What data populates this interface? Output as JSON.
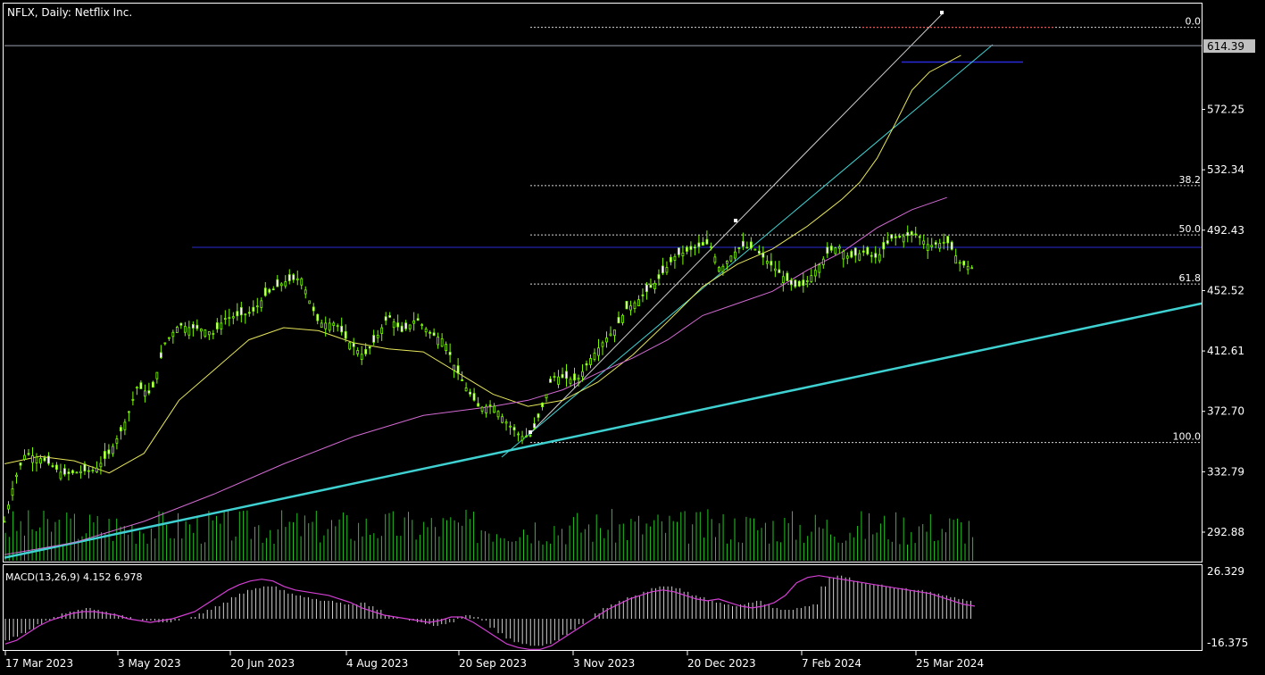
{
  "title": "NFLX, Daily:  Netflix Inc.",
  "macd_label": "MACD(13,26,9) 4.152 6.978",
  "colors": {
    "background": "#000000",
    "candle": "#7CFC00",
    "ma_short": "#e6e65a",
    "ma_long": "#d36ad3",
    "trendline": "#3fd1d1",
    "resistance": "#2a2ad8",
    "macd_signal": "#d23fd2",
    "volume": "#22c322",
    "fib_top": "#ff4040",
    "grid": "#ffffff"
  },
  "chart_data": [
    {
      "type": "candlestick",
      "ylim": [
        274,
        641
      ],
      "y_ticks": [
        572.25,
        532.34,
        492.43,
        452.52,
        412.61,
        372.7,
        332.79,
        292.88
      ],
      "y_tick_labels": [
        "572.25",
        "532.34",
        "492.43",
        "452.52",
        "412.61",
        "372.70",
        "332.79",
        "292.88"
      ],
      "current_price": 614.39,
      "current_price_label": "614.39",
      "x_tick_labels": [
        "17 Mar 2023",
        "3 May 2023",
        "20 Jun 2023",
        "4 Aug 2023",
        "20 Sep 2023",
        "3 Nov 2023",
        "20 Dec 2023",
        "7 Feb 2024",
        "25 Mar 2024"
      ],
      "fibonacci": [
        {
          "label": "0.0",
          "price": 626.5
        },
        {
          "label": "38.2",
          "price": 521.9
        },
        {
          "label": "50.0",
          "price": 489.3
        },
        {
          "label": "61.8",
          "price": 456.8
        },
        {
          "label": "100.0",
          "price": 352.1
        }
      ],
      "horizontal_levels": [
        {
          "name": "resistance",
          "price": 481.1
        },
        {
          "name": "support",
          "price": 603.5
        }
      ],
      "close_path": [
        [
          0,
          300
        ],
        [
          6,
          328
        ],
        [
          12,
          345
        ],
        [
          22,
          341
        ],
        [
          34,
          331
        ],
        [
          44,
          333
        ],
        [
          52,
          334
        ],
        [
          60,
          345
        ],
        [
          66,
          358
        ],
        [
          70,
          368
        ],
        [
          76,
          389
        ],
        [
          84,
          384
        ],
        [
          92,
          418
        ],
        [
          100,
          430
        ],
        [
          106,
          428
        ],
        [
          114,
          427
        ],
        [
          120,
          424
        ],
        [
          126,
          434
        ],
        [
          134,
          436
        ],
        [
          142,
          438
        ],
        [
          150,
          450
        ],
        [
          160,
          458
        ],
        [
          170,
          461
        ],
        [
          174,
          448
        ],
        [
          180,
          431
        ],
        [
          190,
          431
        ],
        [
          196,
          420
        ],
        [
          206,
          409
        ],
        [
          212,
          419
        ],
        [
          220,
          436
        ],
        [
          228,
          425
        ],
        [
          236,
          434
        ],
        [
          244,
          424
        ],
        [
          252,
          420
        ],
        [
          258,
          402
        ],
        [
          264,
          389
        ],
        [
          272,
          375
        ],
        [
          280,
          377
        ],
        [
          288,
          365
        ],
        [
          296,
          356
        ],
        [
          302,
          357
        ],
        [
          308,
          375
        ],
        [
          314,
          396
        ],
        [
          320,
          395
        ],
        [
          328,
          393
        ],
        [
          336,
          408
        ],
        [
          344,
          420
        ],
        [
          350,
          427
        ],
        [
          356,
          440
        ],
        [
          364,
          447
        ],
        [
          374,
          459
        ],
        [
          384,
          475
        ],
        [
          394,
          480
        ],
        [
          404,
          484
        ],
        [
          410,
          466
        ],
        [
          416,
          475
        ],
        [
          422,
          482
        ],
        [
          430,
          480
        ],
        [
          436,
          473
        ],
        [
          446,
          462
        ],
        [
          452,
          455
        ],
        [
          458,
          456
        ],
        [
          466,
          468
        ],
        [
          472,
          478
        ],
        [
          478,
          482
        ],
        [
          484,
          474
        ],
        [
          492,
          478
        ],
        [
          500,
          474
        ],
        [
          508,
          487
        ],
        [
          514,
          488
        ],
        [
          522,
          490
        ],
        [
          530,
          482
        ],
        [
          540,
          485
        ],
        [
          548,
          470
        ],
        [
          556,
          467
        ]
      ],
      "ma_short_path": [
        [
          0,
          338
        ],
        [
          20,
          343
        ],
        [
          40,
          340
        ],
        [
          60,
          332
        ],
        [
          80,
          345
        ],
        [
          100,
          380
        ],
        [
          120,
          400
        ],
        [
          140,
          420
        ],
        [
          160,
          428
        ],
        [
          180,
          426
        ],
        [
          200,
          418
        ],
        [
          220,
          414
        ],
        [
          240,
          412
        ],
        [
          260,
          398
        ],
        [
          280,
          384
        ],
        [
          300,
          376
        ],
        [
          320,
          380
        ],
        [
          340,
          392
        ],
        [
          360,
          410
        ],
        [
          380,
          432
        ],
        [
          400,
          455
        ],
        [
          420,
          470
        ],
        [
          440,
          480
        ],
        [
          460,
          495
        ],
        [
          470,
          504
        ],
        [
          480,
          513
        ],
        [
          490,
          524
        ],
        [
          500,
          540
        ],
        [
          510,
          562
        ],
        [
          520,
          585
        ],
        [
          530,
          597
        ],
        [
          540,
          603
        ],
        [
          548,
          608
        ]
      ],
      "ma_long_path": [
        [
          0,
          278
        ],
        [
          40,
          286
        ],
        [
          80,
          300
        ],
        [
          120,
          318
        ],
        [
          160,
          338
        ],
        [
          200,
          356
        ],
        [
          240,
          370
        ],
        [
          280,
          376
        ],
        [
          300,
          380
        ],
        [
          320,
          387
        ],
        [
          340,
          398
        ],
        [
          360,
          408
        ],
        [
          380,
          420
        ],
        [
          400,
          436
        ],
        [
          420,
          444
        ],
        [
          440,
          452
        ],
        [
          460,
          466
        ],
        [
          480,
          478
        ],
        [
          500,
          494
        ],
        [
          520,
          506
        ],
        [
          540,
          514
        ]
      ],
      "trendlines": [
        {
          "name": "long-trend",
          "from": [
            0,
            276
          ],
          "to": [
            666,
            444
          ]
        },
        {
          "name": "channel-upper",
          "from": [
            296,
            352
          ],
          "to": [
            526,
            626
          ]
        },
        {
          "name": "channel-lower",
          "from": [
            280,
            344
          ],
          "to": [
            556,
            606
          ]
        }
      ],
      "volume": [
        7,
        6,
        8,
        5,
        9,
        7,
        6,
        8,
        9,
        7,
        5,
        6,
        8,
        9,
        7,
        6,
        5,
        8,
        7,
        9
      ]
    },
    {
      "type": "macd",
      "ylim": [
        -16.375,
        26.329
      ],
      "y_tick_labels": [
        "26.329",
        "-16.375"
      ],
      "histogram": [
        -12,
        -10,
        -8,
        -6,
        -3,
        -1,
        1,
        3,
        4,
        5,
        6,
        5,
        4,
        3,
        2,
        1,
        0,
        -1,
        -1,
        -2,
        -2,
        -1,
        0,
        1,
        3,
        5,
        7,
        9,
        12,
        14,
        16,
        17,
        18,
        18,
        16,
        14,
        13,
        12,
        11,
        10,
        10,
        9,
        8,
        8,
        9,
        7,
        5,
        2,
        1,
        0,
        -1,
        -2,
        -3,
        -4,
        -3,
        -2,
        1,
        2,
        1,
        -1,
        -5,
        -8,
        -11,
        -13,
        -14,
        -15,
        -15,
        -14,
        -12,
        -9,
        -6,
        -3,
        0,
        3,
        6,
        8,
        10,
        12,
        13,
        15,
        17,
        18,
        18,
        17,
        15,
        13,
        12,
        10,
        9,
        8,
        7,
        8,
        9,
        10,
        8,
        6,
        5,
        5,
        6,
        7,
        8,
        18,
        23,
        24,
        23,
        21,
        20,
        19,
        19,
        18,
        17,
        17,
        16,
        16,
        15,
        14,
        13,
        12,
        11,
        10
      ],
      "signal": [
        -14,
        -12,
        -8,
        -4,
        -1,
        1,
        3,
        4,
        4,
        3,
        2,
        0,
        -1,
        -2,
        -1,
        0,
        2,
        4,
        8,
        12,
        16,
        19,
        21,
        22,
        21,
        18,
        16,
        15,
        14,
        13,
        11,
        9,
        6,
        4,
        2,
        1,
        0,
        -1,
        -2,
        -1,
        1,
        1,
        -2,
        -6,
        -10,
        -14,
        -16,
        -17,
        -17,
        -15,
        -11,
        -7,
        -3,
        1,
        5,
        8,
        11,
        13,
        15,
        16,
        15,
        13,
        11,
        10,
        11,
        9,
        7,
        6,
        7,
        9,
        13,
        20,
        23,
        24,
        23,
        22,
        21,
        20,
        19,
        18,
        17,
        16,
        15,
        14,
        12,
        10,
        8,
        7
      ]
    }
  ]
}
